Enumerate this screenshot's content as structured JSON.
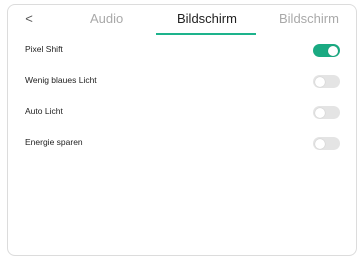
{
  "nav": {
    "back_glyph": "<"
  },
  "tabs": [
    {
      "label": "Audio",
      "active": false
    },
    {
      "label": "Bildschirm",
      "active": true
    },
    {
      "label": "Bildschirm",
      "active": false
    }
  ],
  "settings": [
    {
      "label": "Pixel Shift",
      "enabled": true
    },
    {
      "label": "Wenig blaues Licht",
      "enabled": false
    },
    {
      "label": "Auto Licht",
      "enabled": false
    },
    {
      "label": "Energie sparen",
      "enabled": false
    }
  ],
  "colors": {
    "accent": "#1db38c",
    "toggle_on": "#1aaa82",
    "toggle_off": "#e4e4e4"
  }
}
